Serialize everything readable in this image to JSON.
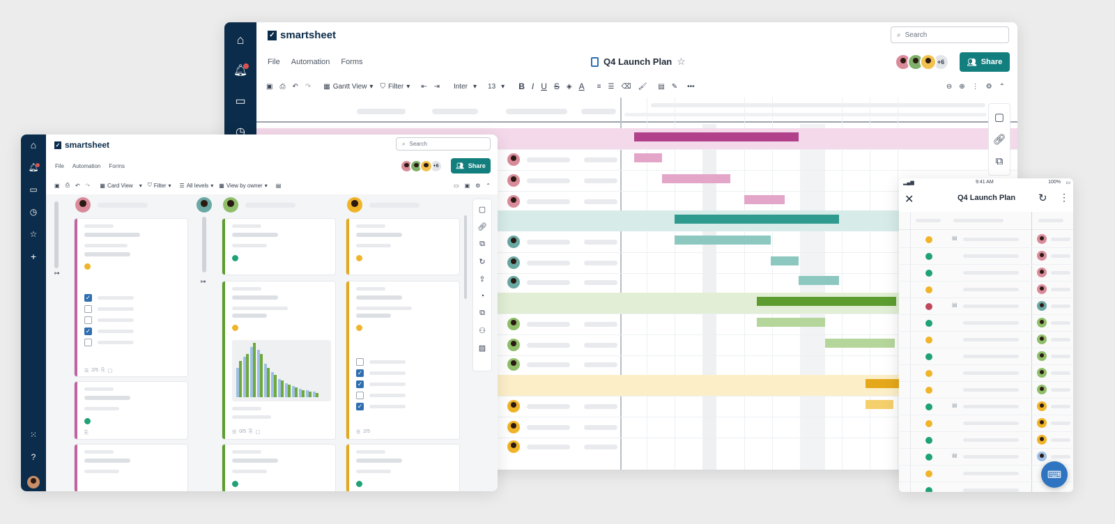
{
  "brand": "smartsheet",
  "back_window": {
    "menus": [
      "File",
      "Automation",
      "Forms"
    ],
    "title": "Q4 Launch Plan",
    "search_placeholder": "Search",
    "share_label": "Share",
    "collaborator_extra": "+6",
    "toolbar": {
      "view": "Gantt View",
      "filter": "Filter",
      "font": "Inter",
      "font_size": "13",
      "bold": "B",
      "italic": "I",
      "underline": "U",
      "strike": "S",
      "font_color": "A",
      "more": "•••"
    },
    "notification_count": "1"
  },
  "front_window": {
    "menus": [
      "File",
      "Automation",
      "Forms"
    ],
    "search_placeholder": "Search",
    "share_label": "Share",
    "collaborator_extra": "+6",
    "toolbar": {
      "view": "Card View",
      "filter": "Filter",
      "levels": "All levels",
      "group": "View by owner"
    },
    "card_meta_1": "2/5",
    "card_meta_2": "0/5",
    "card_meta_3": "2/5",
    "notification_count": "1"
  },
  "mobile": {
    "time": "9:41 AM",
    "battery": "100%",
    "title": "Q4 Launch Plan"
  },
  "colors": {
    "navy": "#0b2c4a",
    "teal": "#137e7e",
    "magenta": "#b0418a",
    "green": "#5d9d2f",
    "yellow": "#e5a81a",
    "status_green": "#1fa276",
    "status_yellow": "#f0b429",
    "status_red": "#c0485d"
  }
}
